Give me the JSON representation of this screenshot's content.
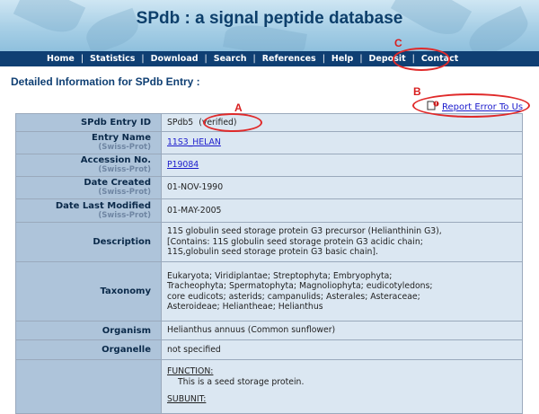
{
  "site": {
    "title": "SPdb : a signal peptide database"
  },
  "nav": [
    "Home",
    "Statistics",
    "Download",
    "Search",
    "References",
    "Help",
    "Deposit",
    "Contact"
  ],
  "page": {
    "subtitle": "Detailed Information for SPdb Entry :"
  },
  "report": {
    "label": "Report Error To Us",
    "icon": "document-error-icon"
  },
  "callouts": {
    "a": "A",
    "b": "B",
    "c": "C"
  },
  "entry": {
    "id": {
      "label": "SPdb Entry ID",
      "value": "SPdb5",
      "status": "(verified)"
    },
    "name": {
      "label": "Entry Name",
      "source": "(Swiss-Prot)",
      "value": "11S3_HELAN"
    },
    "accession": {
      "label": "Accession No.",
      "source": "(Swiss-Prot)",
      "value": "P19084"
    },
    "created": {
      "label": "Date Created",
      "source": "(Swiss-Prot)",
      "value": "01-NOV-1990"
    },
    "modified": {
      "label": "Date Last Modified",
      "source": "(Swiss-Prot)",
      "value": "01-MAY-2005"
    },
    "description": {
      "label": "Description",
      "lines": [
        "11S globulin seed storage protein G3 precursor (Helianthinin G3),",
        "[Contains: 11S globulin seed storage protein G3 acidic chain;",
        "11S,globulin seed storage protein G3 basic chain]."
      ]
    },
    "taxonomy": {
      "label": "Taxonomy",
      "lines": [
        "Eukaryota; Viridiplantae; Streptophyta; Embryophyta;",
        "Tracheophyta; Spermatophyta; Magnoliophyta; eudicotyledons;",
        "core eudicots; asterids; campanulids; Asterales; Asteraceae;",
        "Asteroideae; Heliantheae; Helianthus"
      ]
    },
    "organism": {
      "label": "Organism",
      "value": "Helianthus annuus (Common sunflower)"
    },
    "organelle": {
      "label": "Organelle",
      "value": "not specified"
    },
    "comments": {
      "function_head": "FUNCTION:",
      "function_text": "This is a seed storage protein.",
      "subunit_head": "SUBUNIT:"
    }
  },
  "colors": {
    "nav_bg": "#0f3f73",
    "label_bg": "#aec4da",
    "value_bg": "#dbe7f2",
    "callout": "#e02a2a",
    "link": "#1a1acc"
  }
}
